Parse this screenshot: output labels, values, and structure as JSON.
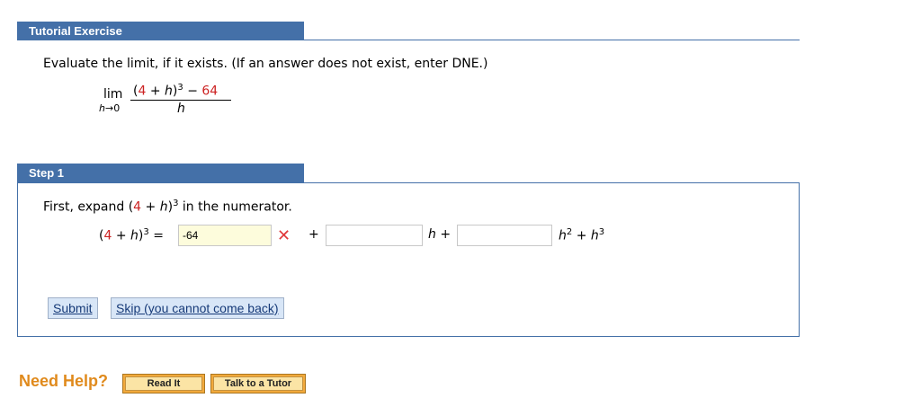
{
  "header": {
    "title": "Tutorial Exercise"
  },
  "problem": {
    "instruction": "Evaluate the limit, if it exists. (If an answer does not exist, enter DNE.)",
    "lim_word": "lim",
    "lim_var": "h",
    "lim_arrow": "→",
    "lim_target": "0",
    "num_open": "(",
    "num_four": "4",
    "num_plus": " + ",
    "num_h": "h",
    "num_close": ")",
    "num_exp": "3",
    "num_minus": " − ",
    "num_const": "64",
    "denominator": "h"
  },
  "step": {
    "title": "Step 1",
    "text_before": "First, expand ",
    "expr_four": "4",
    "expr_h": "h",
    "expr_exp": "3",
    "text_after": " in the numerator.",
    "lhs_four": "4",
    "lhs_h": "h",
    "lhs_exp": "3",
    "equals": " = ",
    "field1_value": "-64",
    "field1_status": "incorrect",
    "plus": "+",
    "field2_value": "",
    "h_term": "h",
    "plus2": " +",
    "field3_value": "",
    "h2_var": "h",
    "h2_exp": "2",
    "plus3": " + ",
    "h3_var": "h",
    "h3_exp": "3"
  },
  "buttons": {
    "submit": "Submit",
    "skip": "Skip (you cannot come back)"
  },
  "help": {
    "label": "Need Help?",
    "read_it": "Read It",
    "talk_tutor": "Talk to a Tutor"
  },
  "colors": {
    "header_bg": "#4470a8",
    "accent_red": "#cc2222",
    "help_orange": "#e08a1c"
  }
}
